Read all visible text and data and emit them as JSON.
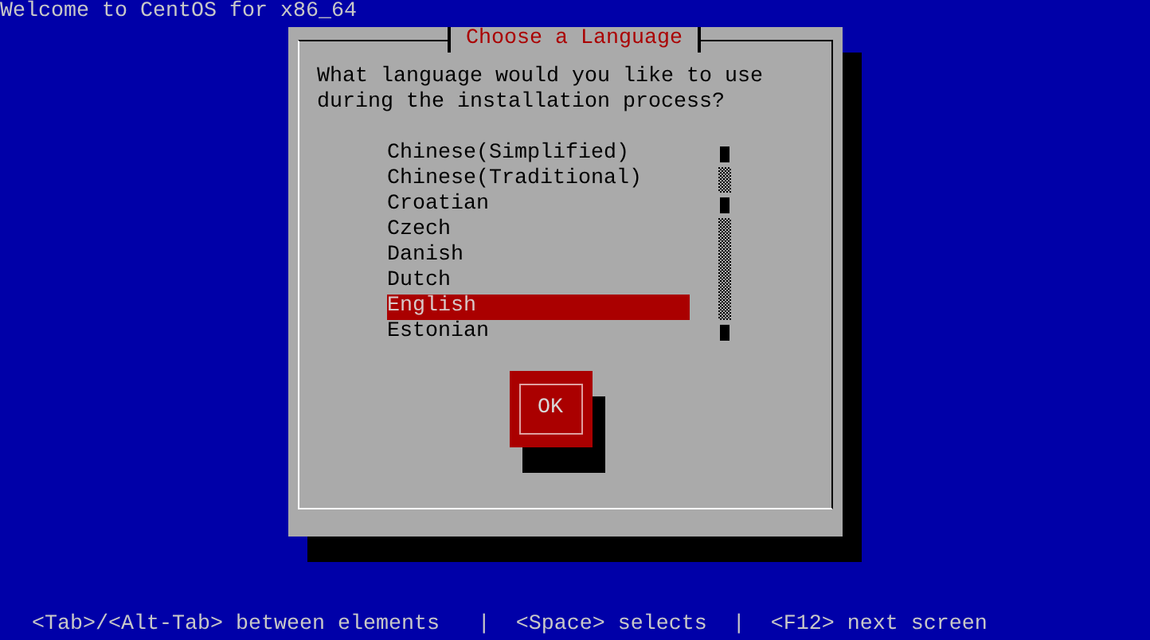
{
  "header": {
    "title": "Welcome to CentOS for x86_64"
  },
  "dialog": {
    "title": "Choose a Language",
    "prompt": "What language would you like to use during the installation process?",
    "languages": [
      {
        "label": "Chinese(Simplified)",
        "selected": false
      },
      {
        "label": "Chinese(Traditional)",
        "selected": false
      },
      {
        "label": "Croatian",
        "selected": false
      },
      {
        "label": "Czech",
        "selected": false
      },
      {
        "label": "Danish",
        "selected": false
      },
      {
        "label": "Dutch",
        "selected": false
      },
      {
        "label": "English",
        "selected": true
      },
      {
        "label": "Estonian",
        "selected": false
      }
    ],
    "buttons": [
      {
        "label": "OK"
      }
    ]
  },
  "footer": {
    "hint": "<Tab>/<Alt-Tab> between elements   |  <Space> selects  |  <F12> next screen"
  }
}
